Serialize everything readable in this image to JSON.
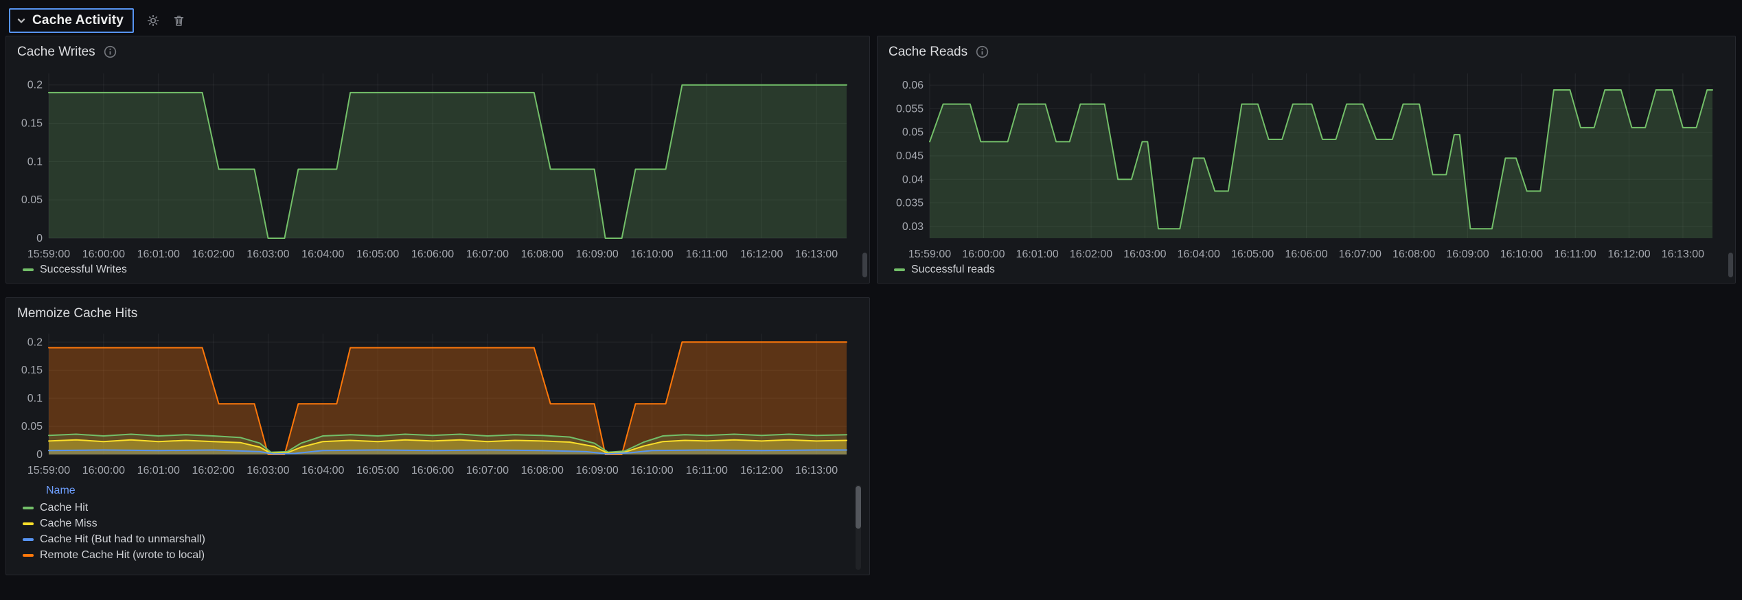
{
  "section_header": {
    "title": "Cache Activity",
    "collapse_icon": "chevron-down",
    "settings_icon": "gear",
    "delete_icon": "trash"
  },
  "panels": [
    {
      "id": "cache_writes",
      "title": "Cache Writes",
      "legend": [
        {
          "label": "Successful Writes",
          "color": "#73BF69"
        }
      ]
    },
    {
      "id": "cache_reads",
      "title": "Cache Reads",
      "legend": [
        {
          "label": "Successful reads",
          "color": "#73BF69"
        }
      ]
    },
    {
      "id": "memoize",
      "title": "Memoize Cache Hits",
      "legend_header": "Name",
      "legend": [
        {
          "label": "Cache Hit",
          "color": "#73BF69"
        },
        {
          "label": "Cache Miss",
          "color": "#FADE2A"
        },
        {
          "label": "Cache Hit (But had to unmarshall)",
          "color": "#5794F2"
        },
        {
          "label": "Remote Cache Hit (wrote to local)",
          "color": "#FF780A"
        }
      ]
    }
  ],
  "chart_data": [
    {
      "id": "cache_writes",
      "type": "area",
      "title": "Cache Writes",
      "xlabel": "",
      "ylabel": "",
      "x_unit": "minutes after 15:59:00",
      "xlim": [
        0,
        14.55
      ],
      "ylim": [
        0,
        0.215
      ],
      "grid": true,
      "legend_position": "bottom-left",
      "x_ticks": [
        [
          0,
          "15:59:00"
        ],
        [
          1,
          "16:00:00"
        ],
        [
          2,
          "16:01:00"
        ],
        [
          3,
          "16:02:00"
        ],
        [
          4,
          "16:03:00"
        ],
        [
          5,
          "16:04:00"
        ],
        [
          6,
          "16:05:00"
        ],
        [
          7,
          "16:06:00"
        ],
        [
          8,
          "16:07:00"
        ],
        [
          9,
          "16:08:00"
        ],
        [
          10,
          "16:09:00"
        ],
        [
          11,
          "16:10:00"
        ],
        [
          12,
          "16:11:00"
        ],
        [
          13,
          "16:12:00"
        ],
        [
          14,
          "16:13:00"
        ]
      ],
      "y_ticks": [
        [
          0,
          "0"
        ],
        [
          0.05,
          "0.05"
        ],
        [
          0.1,
          "0.1"
        ],
        [
          0.15,
          "0.15"
        ],
        [
          0.2,
          "0.2"
        ]
      ],
      "series": [
        {
          "name": "Successful Writes",
          "color": "#73BF69",
          "fill": "rgba(115,191,105,0.21)",
          "points": [
            [
              0,
              0.19
            ],
            [
              2.8,
              0.19
            ],
            [
              3.1,
              0.09
            ],
            [
              3.75,
              0.09
            ],
            [
              4.0,
              0
            ],
            [
              4.3,
              0
            ],
            [
              4.55,
              0.09
            ],
            [
              5.25,
              0.09
            ],
            [
              5.5,
              0.19
            ],
            [
              8.85,
              0.19
            ],
            [
              9.15,
              0.09
            ],
            [
              9.95,
              0.09
            ],
            [
              10.15,
              0
            ],
            [
              10.45,
              0
            ],
            [
              10.7,
              0.09
            ],
            [
              11.25,
              0.09
            ],
            [
              11.55,
              0.2
            ],
            [
              14.55,
              0.2
            ]
          ]
        }
      ]
    },
    {
      "id": "cache_reads",
      "type": "area",
      "title": "Cache Reads",
      "xlabel": "",
      "ylabel": "",
      "x_unit": "minutes after 15:59:00",
      "xlim": [
        0,
        14.55
      ],
      "ylim": [
        0.0275,
        0.0625
      ],
      "grid": true,
      "legend_position": "bottom-left",
      "x_ticks": [
        [
          0,
          "15:59:00"
        ],
        [
          1,
          "16:00:00"
        ],
        [
          2,
          "16:01:00"
        ],
        [
          3,
          "16:02:00"
        ],
        [
          4,
          "16:03:00"
        ],
        [
          5,
          "16:04:00"
        ],
        [
          6,
          "16:05:00"
        ],
        [
          7,
          "16:06:00"
        ],
        [
          8,
          "16:07:00"
        ],
        [
          9,
          "16:08:00"
        ],
        [
          10,
          "16:09:00"
        ],
        [
          11,
          "16:10:00"
        ],
        [
          12,
          "16:11:00"
        ],
        [
          13,
          "16:12:00"
        ],
        [
          14,
          "16:13:00"
        ]
      ],
      "y_ticks": [
        [
          0.03,
          "0.03"
        ],
        [
          0.035,
          "0.035"
        ],
        [
          0.04,
          "0.04"
        ],
        [
          0.045,
          "0.045"
        ],
        [
          0.05,
          "0.05"
        ],
        [
          0.055,
          "0.055"
        ],
        [
          0.06,
          "0.06"
        ]
      ],
      "series": [
        {
          "name": "Successful reads",
          "color": "#73BF69",
          "fill": "rgba(115,191,105,0.21)",
          "points": [
            [
              0,
              0.048
            ],
            [
              0.25,
              0.056
            ],
            [
              0.75,
              0.056
            ],
            [
              0.95,
              0.048
            ],
            [
              1.45,
              0.048
            ],
            [
              1.65,
              0.056
            ],
            [
              2.15,
              0.056
            ],
            [
              2.35,
              0.048
            ],
            [
              2.6,
              0.048
            ],
            [
              2.8,
              0.056
            ],
            [
              3.25,
              0.056
            ],
            [
              3.5,
              0.04
            ],
            [
              3.75,
              0.04
            ],
            [
              3.95,
              0.048
            ],
            [
              4.05,
              0.048
            ],
            [
              4.25,
              0.0295
            ],
            [
              4.65,
              0.0295
            ],
            [
              4.9,
              0.0445
            ],
            [
              5.1,
              0.0445
            ],
            [
              5.3,
              0.0375
            ],
            [
              5.55,
              0.0375
            ],
            [
              5.8,
              0.056
            ],
            [
              6.1,
              0.056
            ],
            [
              6.3,
              0.0485
            ],
            [
              6.55,
              0.0485
            ],
            [
              6.75,
              0.056
            ],
            [
              7.1,
              0.056
            ],
            [
              7.3,
              0.0485
            ],
            [
              7.55,
              0.0485
            ],
            [
              7.75,
              0.056
            ],
            [
              8.05,
              0.056
            ],
            [
              8.3,
              0.0485
            ],
            [
              8.6,
              0.0485
            ],
            [
              8.8,
              0.056
            ],
            [
              9.1,
              0.056
            ],
            [
              9.35,
              0.041
            ],
            [
              9.6,
              0.041
            ],
            [
              9.75,
              0.0495
            ],
            [
              9.85,
              0.0495
            ],
            [
              10.05,
              0.0295
            ],
            [
              10.45,
              0.0295
            ],
            [
              10.7,
              0.0445
            ],
            [
              10.9,
              0.0445
            ],
            [
              11.1,
              0.0375
            ],
            [
              11.35,
              0.0375
            ],
            [
              11.6,
              0.059
            ],
            [
              11.9,
              0.059
            ],
            [
              12.1,
              0.051
            ],
            [
              12.35,
              0.051
            ],
            [
              12.55,
              0.059
            ],
            [
              12.85,
              0.059
            ],
            [
              13.05,
              0.051
            ],
            [
              13.3,
              0.051
            ],
            [
              13.5,
              0.059
            ],
            [
              13.8,
              0.059
            ],
            [
              14.0,
              0.051
            ],
            [
              14.25,
              0.051
            ],
            [
              14.45,
              0.059
            ],
            [
              14.55,
              0.059
            ]
          ]
        }
      ]
    },
    {
      "id": "memoize",
      "type": "area",
      "title": "Memoize Cache Hits",
      "xlabel": "",
      "ylabel": "",
      "x_unit": "minutes after 15:59:00",
      "xlim": [
        0,
        14.55
      ],
      "ylim": [
        0,
        0.215
      ],
      "grid": true,
      "legend_position": "bottom-left",
      "x_ticks": [
        [
          0,
          "15:59:00"
        ],
        [
          1,
          "16:00:00"
        ],
        [
          2,
          "16:01:00"
        ],
        [
          3,
          "16:02:00"
        ],
        [
          4,
          "16:03:00"
        ],
        [
          5,
          "16:04:00"
        ],
        [
          6,
          "16:05:00"
        ],
        [
          7,
          "16:06:00"
        ],
        [
          8,
          "16:07:00"
        ],
        [
          9,
          "16:08:00"
        ],
        [
          10,
          "16:09:00"
        ],
        [
          11,
          "16:10:00"
        ],
        [
          12,
          "16:11:00"
        ],
        [
          13,
          "16:12:00"
        ],
        [
          14,
          "16:13:00"
        ]
      ],
      "y_ticks": [
        [
          0,
          "0"
        ],
        [
          0.05,
          "0.05"
        ],
        [
          0.1,
          "0.1"
        ],
        [
          0.15,
          "0.15"
        ],
        [
          0.2,
          "0.2"
        ]
      ],
      "series": [
        {
          "name": "Remote Cache Hit (wrote to local)",
          "color": "#FF780A",
          "fill": "rgba(255,120,10,0.30)",
          "points": [
            [
              0,
              0.19
            ],
            [
              2.8,
              0.19
            ],
            [
              3.1,
              0.09
            ],
            [
              3.75,
              0.09
            ],
            [
              4.0,
              0
            ],
            [
              4.3,
              0
            ],
            [
              4.55,
              0.09
            ],
            [
              5.25,
              0.09
            ],
            [
              5.5,
              0.19
            ],
            [
              8.85,
              0.19
            ],
            [
              9.15,
              0.09
            ],
            [
              9.95,
              0.09
            ],
            [
              10.15,
              0
            ],
            [
              10.45,
              0
            ],
            [
              10.7,
              0.09
            ],
            [
              11.25,
              0.09
            ],
            [
              11.55,
              0.2
            ],
            [
              14.55,
              0.2
            ]
          ]
        },
        {
          "name": "Cache Hit",
          "color": "#73BF69",
          "fill": "rgba(115,191,105,0.18)",
          "points": [
            [
              0,
              0.034
            ],
            [
              0.5,
              0.036
            ],
            [
              1,
              0.033
            ],
            [
              1.5,
              0.036
            ],
            [
              2,
              0.033
            ],
            [
              2.5,
              0.035
            ],
            [
              3,
              0.033
            ],
            [
              3.5,
              0.03
            ],
            [
              3.85,
              0.02
            ],
            [
              4.05,
              0.004
            ],
            [
              4.35,
              0.005
            ],
            [
              4.6,
              0.02
            ],
            [
              5,
              0.033
            ],
            [
              5.5,
              0.035
            ],
            [
              6,
              0.033
            ],
            [
              6.5,
              0.036
            ],
            [
              7,
              0.034
            ],
            [
              7.5,
              0.036
            ],
            [
              8,
              0.033
            ],
            [
              8.5,
              0.035
            ],
            [
              9,
              0.034
            ],
            [
              9.5,
              0.031
            ],
            [
              9.95,
              0.02
            ],
            [
              10.2,
              0.004
            ],
            [
              10.5,
              0.006
            ],
            [
              10.85,
              0.022
            ],
            [
              11.2,
              0.033
            ],
            [
              11.6,
              0.035
            ],
            [
              12,
              0.034
            ],
            [
              12.5,
              0.036
            ],
            [
              13,
              0.034
            ],
            [
              13.5,
              0.036
            ],
            [
              14,
              0.034
            ],
            [
              14.55,
              0.035
            ]
          ]
        },
        {
          "name": "Cache Miss",
          "color": "#FADE2A",
          "fill": "rgba(250,222,42,0.35)",
          "points": [
            [
              0,
              0.024
            ],
            [
              0.5,
              0.026
            ],
            [
              1,
              0.023
            ],
            [
              1.5,
              0.026
            ],
            [
              2,
              0.023
            ],
            [
              2.5,
              0.025
            ],
            [
              3,
              0.023
            ],
            [
              3.5,
              0.021
            ],
            [
              3.85,
              0.013
            ],
            [
              4.05,
              0.002
            ],
            [
              4.35,
              0.003
            ],
            [
              4.6,
              0.013
            ],
            [
              5,
              0.023
            ],
            [
              5.5,
              0.025
            ],
            [
              6,
              0.023
            ],
            [
              6.5,
              0.026
            ],
            [
              7,
              0.024
            ],
            [
              7.5,
              0.026
            ],
            [
              8,
              0.023
            ],
            [
              8.5,
              0.025
            ],
            [
              9,
              0.024
            ],
            [
              9.5,
              0.022
            ],
            [
              9.95,
              0.014
            ],
            [
              10.2,
              0.002
            ],
            [
              10.5,
              0.004
            ],
            [
              10.85,
              0.015
            ],
            [
              11.2,
              0.023
            ],
            [
              11.6,
              0.025
            ],
            [
              12,
              0.024
            ],
            [
              12.5,
              0.026
            ],
            [
              13,
              0.024
            ],
            [
              13.5,
              0.026
            ],
            [
              14,
              0.024
            ],
            [
              14.55,
              0.025
            ]
          ]
        },
        {
          "name": "Cache Hit (But had to unmarshall)",
          "color": "#5794F2",
          "fill": "rgba(87,148,242,0.20)",
          "points": [
            [
              0,
              0.007
            ],
            [
              1,
              0.008
            ],
            [
              2,
              0.007
            ],
            [
              3,
              0.008
            ],
            [
              3.85,
              0.005
            ],
            [
              4.1,
              0.001
            ],
            [
              4.5,
              0.002
            ],
            [
              5,
              0.007
            ],
            [
              6,
              0.008
            ],
            [
              7,
              0.007
            ],
            [
              8,
              0.008
            ],
            [
              9,
              0.007
            ],
            [
              9.8,
              0.005
            ],
            [
              10.2,
              0.001
            ],
            [
              10.6,
              0.003
            ],
            [
              11,
              0.007
            ],
            [
              12,
              0.008
            ],
            [
              13,
              0.007
            ],
            [
              14,
              0.008
            ],
            [
              14.55,
              0.008
            ]
          ]
        }
      ]
    }
  ]
}
